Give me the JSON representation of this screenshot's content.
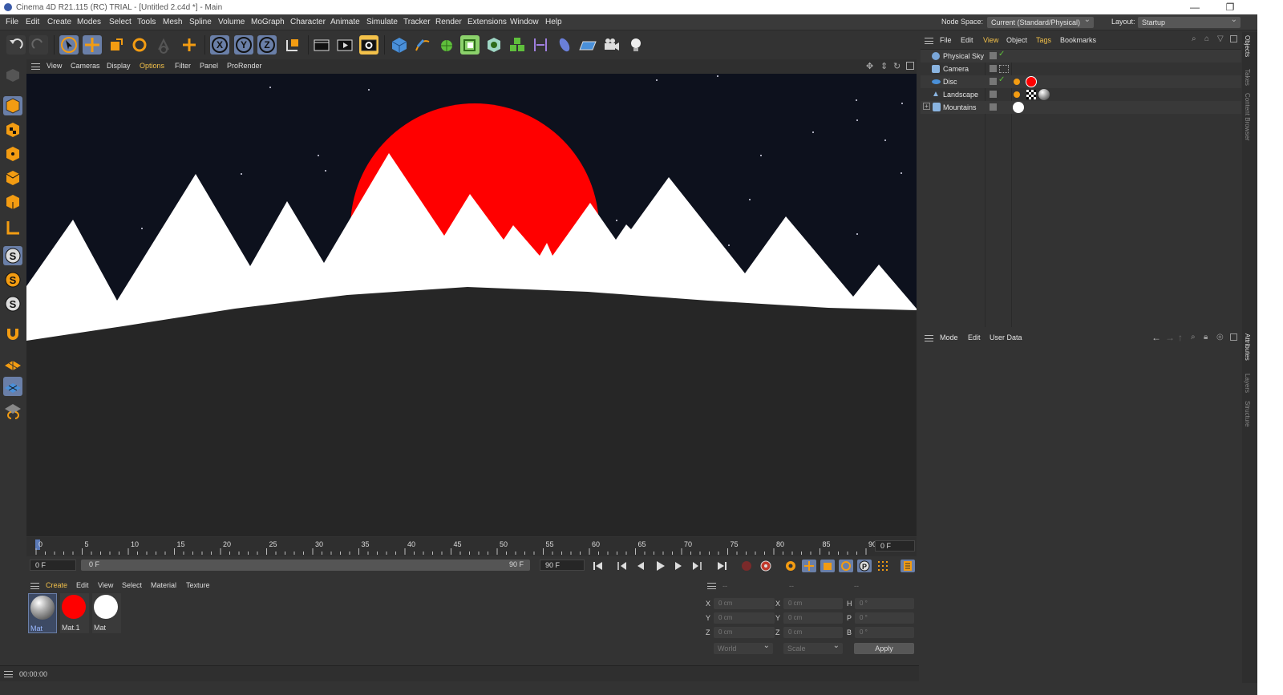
{
  "window": {
    "title": "Cinema 4D R21.115 (RC) TRIAL - [Untitled 2.c4d *] - Main",
    "controls": [
      "—",
      "❐",
      "✕"
    ]
  },
  "menubar": {
    "items": [
      "File",
      "Edit",
      "Create",
      "Modes",
      "Select",
      "Tools",
      "Mesh",
      "Spline",
      "Volume",
      "MoGraph",
      "Character",
      "Animate",
      "Simulate",
      "Tracker",
      "Render",
      "Extensions",
      "Window",
      "Help"
    ],
    "node_space_label": "Node Space:",
    "node_space_value": "Current (Standard/Physical)",
    "layout_label": "Layout:",
    "layout_value": "Startup"
  },
  "toolbar": {
    "axis_x": "X",
    "axis_y": "Y",
    "axis_z": "Z"
  },
  "viewport": {
    "menu": [
      "View",
      "Cameras",
      "Display",
      "Options",
      "Filter",
      "Panel",
      "ProRender"
    ],
    "sky_color": "#0d111d",
    "sun_color": "#ff0000",
    "ground_color": "#262626",
    "mountain_color": "#ffffff"
  },
  "timeline": {
    "ticks": [
      "0",
      "5",
      "10",
      "15",
      "20",
      "25",
      "30",
      "35",
      "40",
      "45",
      "50",
      "55",
      "60",
      "65",
      "70",
      "75",
      "80",
      "85",
      "90"
    ],
    "current_frame": "0 F",
    "start_frame": "0 F",
    "range_start": "0 F",
    "range_end": "90 F",
    "end_frame": "90 F"
  },
  "materials": {
    "menu": [
      "Create",
      "Edit",
      "View",
      "Select",
      "Material",
      "Texture"
    ],
    "items": [
      {
        "name": "Mat",
        "color": "#b0b0b0"
      },
      {
        "name": "Mat.1",
        "color": "#ff0000"
      },
      {
        "name": "Mat",
        "color": "#ffffff"
      }
    ]
  },
  "coords": {
    "headers": [
      "--",
      "--",
      "--"
    ],
    "rows": [
      {
        "a": "X",
        "av": "0 cm",
        "b": "X",
        "bv": "0 cm",
        "c": "H",
        "cv": "0 °"
      },
      {
        "a": "Y",
        "av": "0 cm",
        "b": "Y",
        "bv": "0 cm",
        "c": "P",
        "cv": "0 °"
      },
      {
        "a": "Z",
        "av": "0 cm",
        "b": "Z",
        "bv": "0 cm",
        "c": "B",
        "cv": "0 °"
      }
    ],
    "space": "World",
    "mode": "Scale",
    "apply": "Apply"
  },
  "status": {
    "time": "00:00:00"
  },
  "objects": {
    "menu": [
      "File",
      "Edit",
      "View",
      "Object",
      "Tags",
      "Bookmarks"
    ],
    "items": [
      "Physical Sky",
      "Camera",
      "Disc",
      "Landscape",
      "Mountains"
    ]
  },
  "attributes": {
    "menu": [
      "Mode",
      "Edit",
      "User Data"
    ]
  },
  "side_tabs": {
    "top": [
      "Objects",
      "Takes",
      "Content Browser"
    ],
    "bottom": [
      "Attributes",
      "Layers",
      "Structure"
    ]
  }
}
